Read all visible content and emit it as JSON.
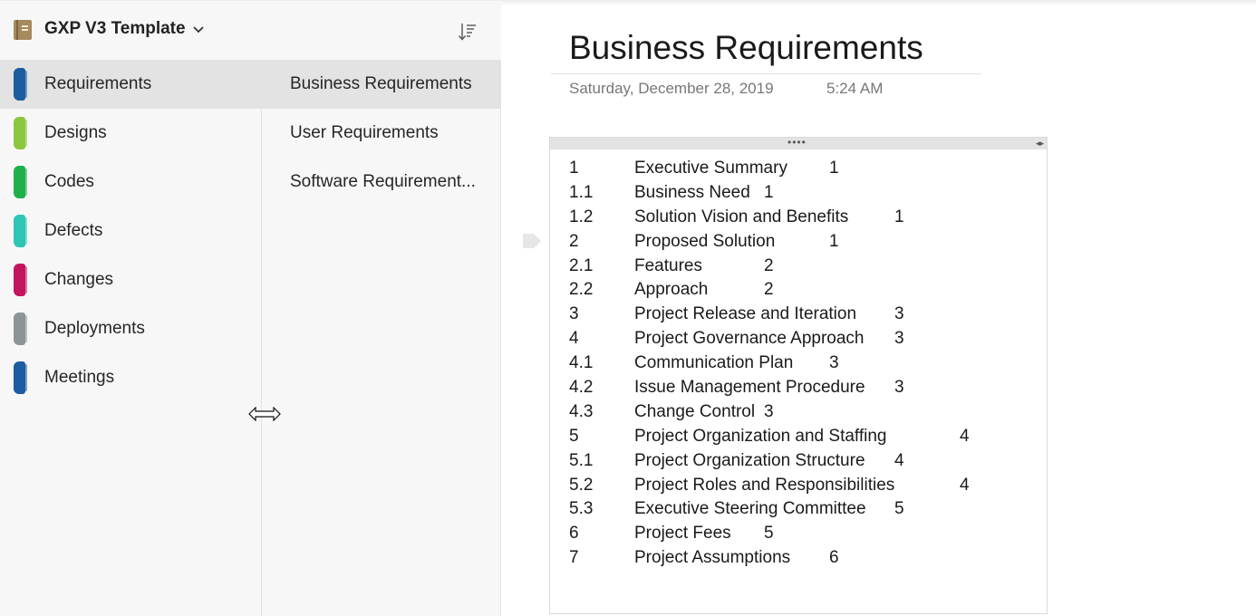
{
  "notebook": {
    "title": "GXP V3 Template",
    "chevron": "⌄",
    "icon": "notebook-icon",
    "color": "#a58a5c"
  },
  "sections": [
    {
      "label": "Requirements",
      "color": "#1c5c9f",
      "active": true
    },
    {
      "label": "Designs",
      "color": "#8cc63f",
      "active": false
    },
    {
      "label": "Codes",
      "color": "#1fb04b",
      "active": false
    },
    {
      "label": "Defects",
      "color": "#2ec5b6",
      "active": false
    },
    {
      "label": "Changes",
      "color": "#c4165e",
      "active": false
    },
    {
      "label": "Deployments",
      "color": "#8d9498",
      "active": false
    },
    {
      "label": "Meetings",
      "color": "#1c5c9f",
      "active": false
    }
  ],
  "pages": [
    {
      "label": "Business Requirements",
      "active": true
    },
    {
      "label": "User Requirements",
      "active": false
    },
    {
      "label": "Software Requirement...",
      "active": false
    }
  ],
  "page": {
    "title": "Business Requirements",
    "date": "Saturday, December 28, 2019",
    "time": "5:24 AM"
  },
  "container": {
    "handle": "••••",
    "arrows": "◂▸"
  },
  "toc": [
    {
      "num": "1",
      "title": "Executive Summary",
      "page": "1"
    },
    {
      "num": "1.1",
      "title": "Business Need",
      "page": "1"
    },
    {
      "num": "1.2",
      "title": "Solution Vision and Benefits",
      "page": "1"
    },
    {
      "num": "2",
      "title": "Proposed Solution",
      "page": "1"
    },
    {
      "num": "2.1",
      "title": "Features",
      "page": "2"
    },
    {
      "num": "2.2",
      "title": "Approach",
      "page": "2"
    },
    {
      "num": "3",
      "title": "Project Release and Iteration",
      "page": "3"
    },
    {
      "num": "4",
      "title": "Project Governance Approach",
      "page": "3"
    },
    {
      "num": "4.1",
      "title": "Communication Plan",
      "page": "3"
    },
    {
      "num": "4.2",
      "title": "Issue Management Procedure",
      "page": "3"
    },
    {
      "num": "4.3",
      "title": "Change Control",
      "page": "3"
    },
    {
      "num": "5",
      "title": "Project Organization and Staffing",
      "page": "4"
    },
    {
      "num": "5.1",
      "title": "Project Organization Structure",
      "page": "4"
    },
    {
      "num": "5.2",
      "title": "Project Roles and Responsibilities",
      "page": "4"
    },
    {
      "num": "5.3",
      "title": "Executive Steering Committee",
      "page": "5"
    },
    {
      "num": "6",
      "title": "Project Fees",
      "page": "5"
    },
    {
      "num": "7",
      "title": "Project Assumptions",
      "page": "6"
    }
  ]
}
